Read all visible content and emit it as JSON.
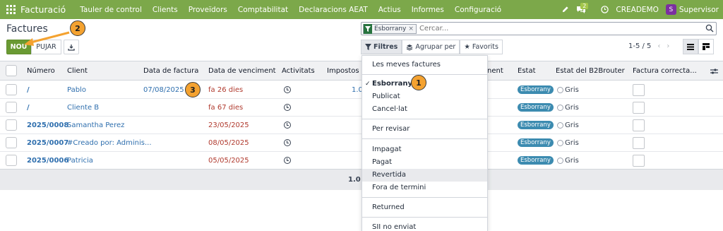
{
  "app": {
    "name": "Facturació",
    "menu": [
      "Tauler de control",
      "Clients",
      "Proveïdors",
      "Comptabilitat",
      "Declaracions AEAT",
      "Actius",
      "Informes",
      "Configuració"
    ],
    "chat_count": "2",
    "company": "CREADEMO",
    "user_initial": "S",
    "user_name": "Supervisor"
  },
  "page": {
    "title": "Factures",
    "new_label": "NOU",
    "upload_label": "PUJAR"
  },
  "search": {
    "facet_value": "Esborrany",
    "facet_remove": "×",
    "placeholder": "Cercar..."
  },
  "toolbar": {
    "filters_label": "Filtres",
    "groupby_label": "Agrupar per",
    "favorites_label": "Favorits",
    "pager": "1-5 / 5"
  },
  "table": {
    "headers": {
      "numero": "Número",
      "client": "Client",
      "data_factura": "Data de factura",
      "data_venciment": "Data de venciment",
      "activitats": "Activitats",
      "impostos": "Impostos e",
      "hidden": "nent",
      "estat": "Estat",
      "estat_b2b": "Estat del B2Brouter",
      "factura_correcta": "Factura correcta..."
    },
    "rows": [
      {
        "numero": "/",
        "client": "Pablo",
        "data_factura": "07/08/2025",
        "data_venciment": "fa 26 dies",
        "impostos": "1.0",
        "estat": "Esborrany",
        "b2b": "Gris"
      },
      {
        "numero": "/",
        "client": "Cliente B",
        "data_factura": "",
        "data_venciment": "fa 67 dies",
        "impostos": "",
        "estat": "Esborrany",
        "b2b": "Gris"
      },
      {
        "numero": "2025/0008",
        "client": "Samantha Perez",
        "data_factura": "",
        "data_venciment": "23/05/2025",
        "impostos": "",
        "estat": "Esborrany",
        "b2b": "Gris"
      },
      {
        "numero": "2025/0007",
        "client": "#Creado por: Adminis...",
        "data_factura": "",
        "data_venciment": "08/05/2025",
        "impostos": "",
        "estat": "Esborrany",
        "b2b": "Gris"
      },
      {
        "numero": "2025/0006",
        "client": "Patricia",
        "data_factura": "",
        "data_venciment": "05/05/2025",
        "impostos": "",
        "estat": "Esborrany",
        "b2b": "Gris"
      }
    ],
    "footer_total": "1.0"
  },
  "filters_menu": {
    "items": [
      "Les meves factures",
      "Esborrany",
      "Publicat",
      "Cancel·lat",
      "Per revisar",
      "Impagat",
      "Pagat",
      "Revertida",
      "Fora de termini",
      "Returned",
      "SII no enviat"
    ]
  },
  "callouts": {
    "one": "1",
    "two": "2",
    "three": "3"
  },
  "colors": {
    "nav": "#7ca84a",
    "primary_button": "#6a9a33",
    "overdue": "#b03a2e",
    "status_pill": "#3c8bb0",
    "callout": "#f4a230"
  }
}
